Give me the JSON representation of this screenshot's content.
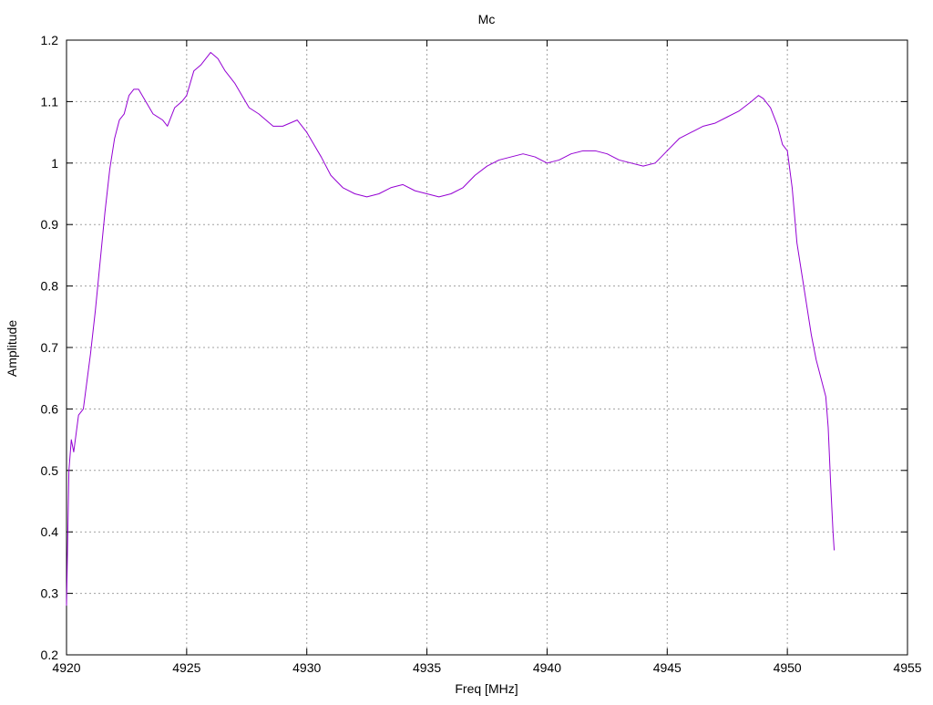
{
  "chart_data": {
    "type": "line",
    "title": "Mc",
    "xlabel": "Freq [MHz]",
    "ylabel": "Amplitude",
    "xlim": [
      4920,
      4955
    ],
    "ylim": [
      0.2,
      1.2
    ],
    "xticks": [
      "4920",
      "4925",
      "4930",
      "4935",
      "4940",
      "4945",
      "4950",
      "4955"
    ],
    "yticks": [
      "0.2",
      "0.3",
      "0.4",
      "0.5",
      "0.6",
      "0.7",
      "0.8",
      "0.9",
      "1",
      "1.1",
      "1.2"
    ],
    "grid": true,
    "legend": "none",
    "series": [
      {
        "color": "#9400d3",
        "x": [
          4920.0,
          4920.1,
          4920.2,
          4920.3,
          4920.5,
          4920.7,
          4920.9,
          4921.0,
          4921.2,
          4921.4,
          4921.6,
          4921.8,
          4922.0,
          4922.2,
          4922.4,
          4922.6,
          4922.8,
          4923.0,
          4923.3,
          4923.6,
          4924.0,
          4924.2,
          4924.5,
          4924.8,
          4925.0,
          4925.3,
          4925.6,
          4926.0,
          4926.3,
          4926.6,
          4927.0,
          4927.3,
          4927.6,
          4928.0,
          4928.3,
          4928.6,
          4929.0,
          4929.3,
          4929.6,
          4930.0,
          4930.3,
          4930.6,
          4931.0,
          4931.5,
          4932.0,
          4932.5,
          4933.0,
          4933.5,
          4934.0,
          4934.5,
          4935.0,
          4935.5,
          4936.0,
          4936.5,
          4937.0,
          4937.5,
          4938.0,
          4938.5,
          4939.0,
          4939.5,
          4940.0,
          4940.5,
          4941.0,
          4941.5,
          4942.0,
          4942.5,
          4943.0,
          4943.5,
          4944.0,
          4944.5,
          4945.0,
          4945.5,
          4946.0,
          4946.5,
          4947.0,
          4947.5,
          4948.0,
          4948.5,
          4948.8,
          4949.0,
          4949.3,
          4949.6,
          4949.8,
          4950.0,
          4950.2,
          4950.4,
          4950.6,
          4950.8,
          4951.0,
          4951.2,
          4951.4,
          4951.6,
          4951.7,
          4951.8,
          4951.9,
          4951.95
        ],
        "values": [
          0.28,
          0.5,
          0.55,
          0.53,
          0.59,
          0.6,
          0.66,
          0.69,
          0.76,
          0.84,
          0.92,
          0.99,
          1.04,
          1.07,
          1.08,
          1.11,
          1.12,
          1.12,
          1.1,
          1.08,
          1.07,
          1.06,
          1.09,
          1.1,
          1.11,
          1.15,
          1.16,
          1.18,
          1.17,
          1.15,
          1.13,
          1.11,
          1.09,
          1.08,
          1.07,
          1.06,
          1.06,
          1.065,
          1.07,
          1.05,
          1.03,
          1.01,
          0.98,
          0.96,
          0.95,
          0.945,
          0.95,
          0.96,
          0.965,
          0.955,
          0.95,
          0.945,
          0.95,
          0.96,
          0.98,
          0.995,
          1.005,
          1.01,
          1.015,
          1.01,
          1.0,
          1.005,
          1.015,
          1.02,
          1.02,
          1.015,
          1.005,
          1.0,
          0.995,
          1.0,
          1.02,
          1.04,
          1.05,
          1.06,
          1.065,
          1.075,
          1.085,
          1.1,
          1.11,
          1.105,
          1.09,
          1.06,
          1.03,
          1.02,
          0.96,
          0.87,
          0.82,
          0.77,
          0.72,
          0.68,
          0.65,
          0.62,
          0.57,
          0.48,
          0.4,
          0.37
        ]
      }
    ]
  }
}
